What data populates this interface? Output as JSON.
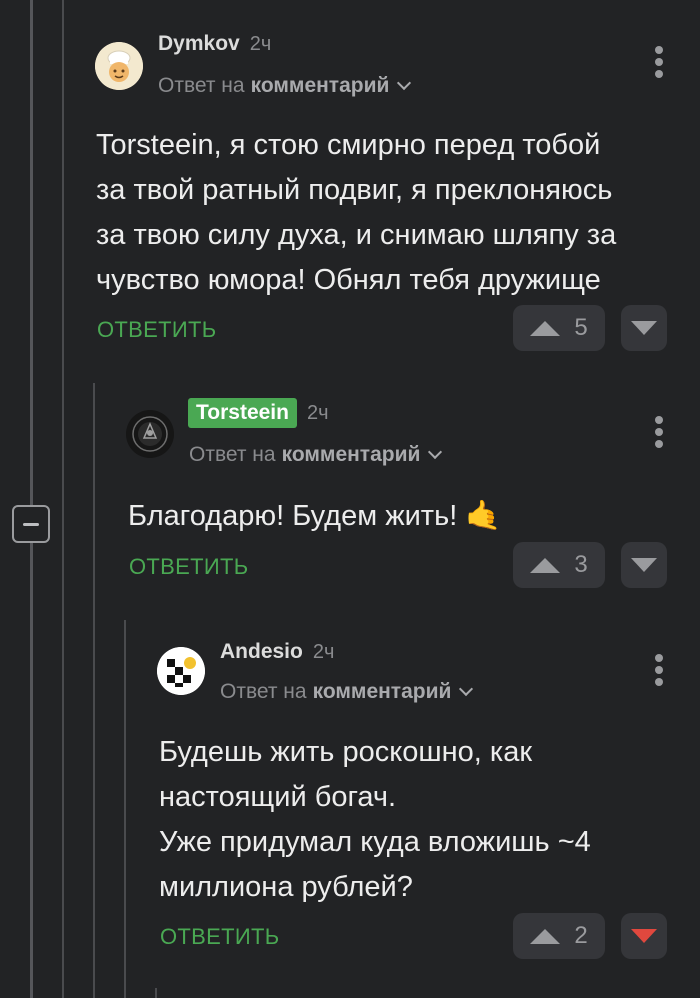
{
  "comments": [
    {
      "author": "Dymkov",
      "time": "2ч",
      "reply_prefix": "Ответ на",
      "reply_target": "комментарий",
      "text_lines": [
        "Torsteein, я стою смирно перед тобой",
        "за твой ратный подвиг, я преклоняюсь",
        "за твою силу духа, и снимаю шляпу за",
        "чувство юмора! Обнял тебя дружище"
      ],
      "reply_label": "ОТВЕТИТЬ",
      "votes": "5"
    },
    {
      "author": "Torsteein",
      "time": "2ч",
      "reply_prefix": "Ответ на",
      "reply_target": "комментарий",
      "text_lines": [
        "Благодарю! Будем жить! 🤙"
      ],
      "reply_label": "ОТВЕТИТЬ",
      "votes": "3"
    },
    {
      "author": "Andesio",
      "time": "2ч",
      "reply_prefix": "Ответ на",
      "reply_target": "комментарий",
      "text_lines": [
        "Будешь жить роскошно, как",
        "настоящий богач.",
        "Уже придумал куда вложишь ~4",
        "миллиона рублей?"
      ],
      "reply_label": "ОТВЕТИТЬ",
      "votes": "2"
    }
  ],
  "colors": {
    "background": "#222325",
    "accent_green": "#4aa853",
    "downvote_active": "#e0483e",
    "muted_text": "#8a8b8e"
  }
}
